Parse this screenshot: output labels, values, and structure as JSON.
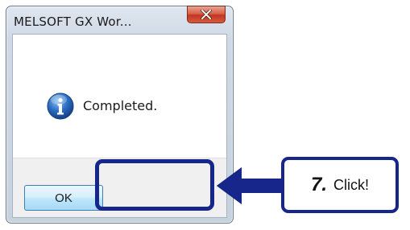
{
  "dialog": {
    "title": "MELSOFT GX Wor...",
    "message": "Completed.",
    "ok_label": "OK",
    "icon": "info-icon",
    "close_icon": "close-icon"
  },
  "annotation": {
    "step_number": "7.",
    "step_text": "Click!",
    "accent_color": "#17268a"
  }
}
